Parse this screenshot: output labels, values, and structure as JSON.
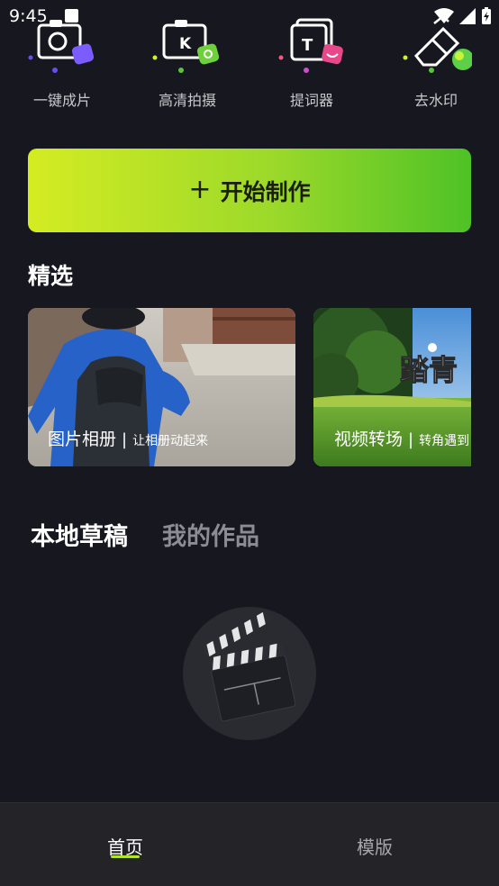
{
  "status_bar": {
    "time": "9:45"
  },
  "tools": [
    {
      "label": "一键成片",
      "icon": "camera-icon"
    },
    {
      "label": "高清拍摄",
      "icon": "hd-camera-icon"
    },
    {
      "label": "提词器",
      "icon": "teleprompter-icon"
    },
    {
      "label": "去水印",
      "icon": "eraser-icon"
    }
  ],
  "cta": {
    "plus": "+",
    "label": "开始制作",
    "gradient": [
      "#d4ec22",
      "#4ec226"
    ]
  },
  "featured": {
    "title": "精选",
    "cards": [
      {
        "name": "图片相册",
        "separator": "|",
        "desc": "让相册动起来"
      },
      {
        "name": "视频转场",
        "separator": "|",
        "desc": "转角遇到"
      }
    ]
  },
  "drafts": {
    "tabs": [
      {
        "label": "本地草稿",
        "active": true
      },
      {
        "label": "我的作品",
        "active": false
      }
    ]
  },
  "bottom_nav": {
    "items": [
      {
        "label": "首页",
        "active": true
      },
      {
        "label": "模版",
        "active": false
      }
    ],
    "accent": "#b0e62a"
  }
}
